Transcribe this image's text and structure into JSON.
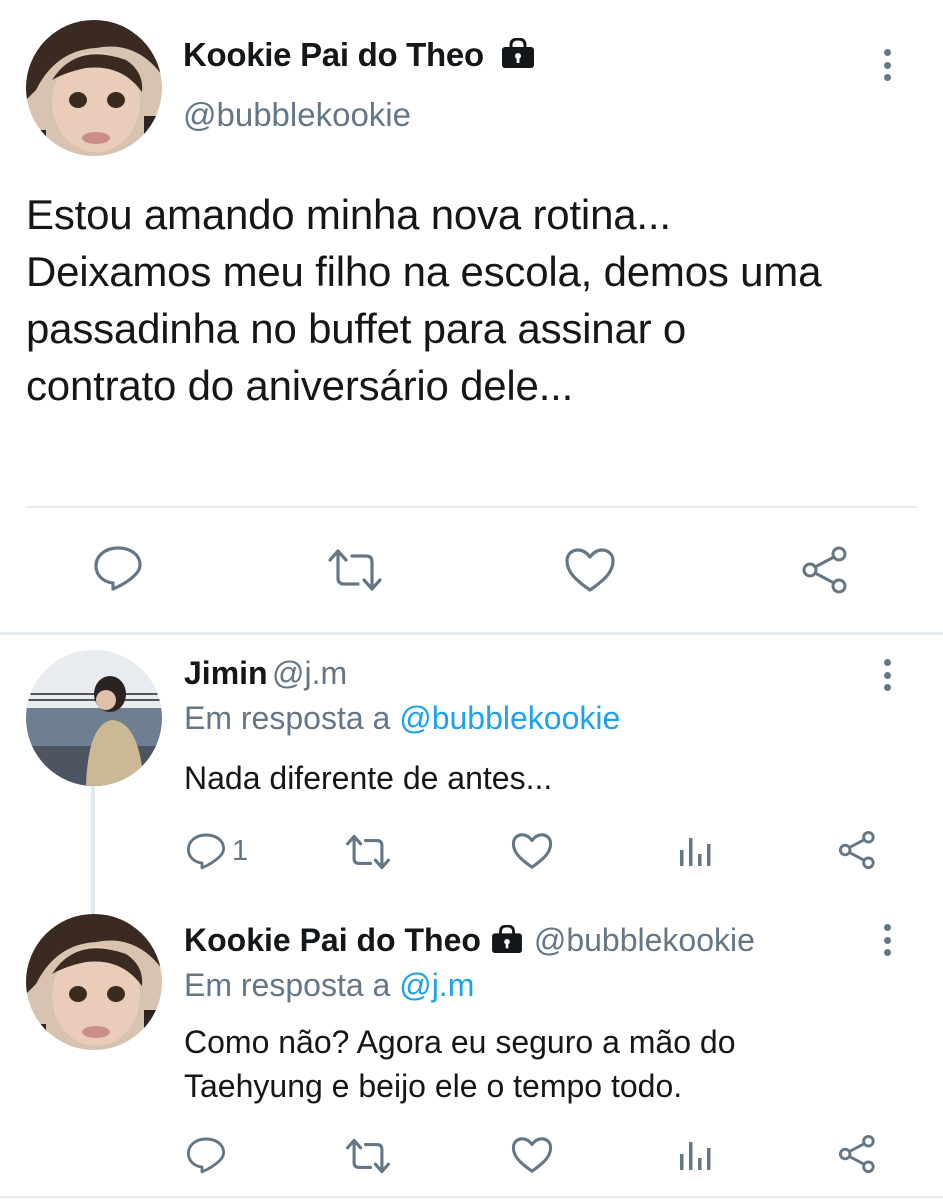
{
  "main_tweet": {
    "display_name": "Kookie Pai do Theo",
    "handle": "@bubblekookie",
    "text_lines": [
      "Estou amando minha nova rotina...",
      "Deixamos meu filho na escola, demos uma",
      "passadinha no buffet para assinar o",
      "contrato do aniversário dele..."
    ],
    "protected_icon": "lock-icon",
    "actions": [
      "reply-icon",
      "retweet-icon",
      "like-icon",
      "share-icon"
    ]
  },
  "replies": [
    {
      "display_name": "Jimin",
      "handle": "@j.m",
      "in_reply_prefix": "Em resposta a ",
      "in_reply_to": "@bubblekookie",
      "text_lines": [
        "Nada diferente de antes..."
      ],
      "reply_count": "1",
      "actions": [
        "reply-icon",
        "retweet-icon",
        "like-icon",
        "analytics-icon",
        "share-icon"
      ]
    },
    {
      "display_name": "Kookie Pai do Theo",
      "handle": "@bubblekookie",
      "in_reply_prefix": "Em resposta a ",
      "in_reply_to": "@j.m",
      "text_lines": [
        "Como não? Agora eu seguro a mão do",
        "Taehyung e beijo ele o tempo todo."
      ],
      "reply_count": "",
      "actions": [
        "reply-icon",
        "retweet-icon",
        "like-icon",
        "analytics-icon",
        "share-icon"
      ]
    }
  ],
  "colors": {
    "text": "#14171a",
    "secondary": "#657786",
    "link": "#1da1f2",
    "separator": "#e6ecf0"
  }
}
